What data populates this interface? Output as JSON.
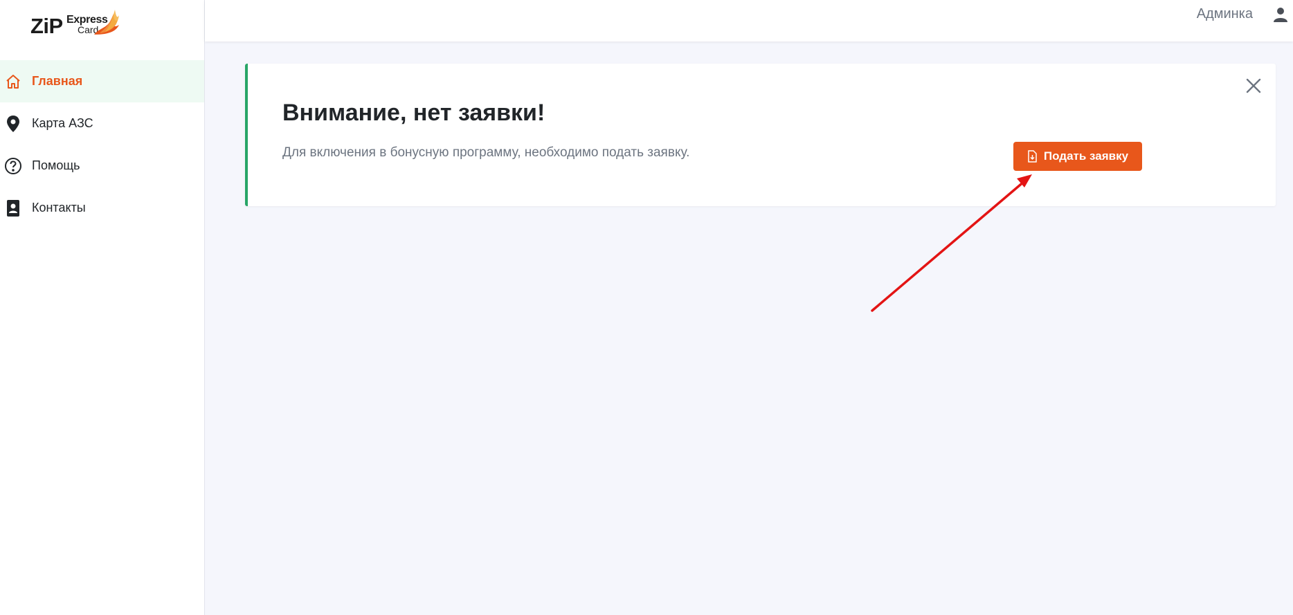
{
  "logo": {
    "brand": "ZiP",
    "line1": "Express",
    "line2": "Card"
  },
  "sidebar": {
    "items": [
      {
        "label": "Главная",
        "icon": "home-icon",
        "active": true
      },
      {
        "label": "Карта АЗС",
        "icon": "map-pin-icon",
        "active": false
      },
      {
        "label": "Помощь",
        "icon": "question-circle-icon",
        "active": false
      },
      {
        "label": "Контакты",
        "icon": "contact-card-icon",
        "active": false
      }
    ]
  },
  "header": {
    "user_name": "Админка",
    "user_icon": "user-icon"
  },
  "alert": {
    "title": "Внимание, нет заявки!",
    "text": "Для включения в бонусную программу, необходимо подать заявку.",
    "button_label": "Подать заявку",
    "button_icon": "document-icon",
    "close_icon": "close-icon"
  },
  "colors": {
    "accent": "#e8571b",
    "success_border": "#28a567",
    "active_bg": "#eefaf3",
    "page_bg": "#f5f6fc",
    "annotation_arrow": "#e31414"
  }
}
